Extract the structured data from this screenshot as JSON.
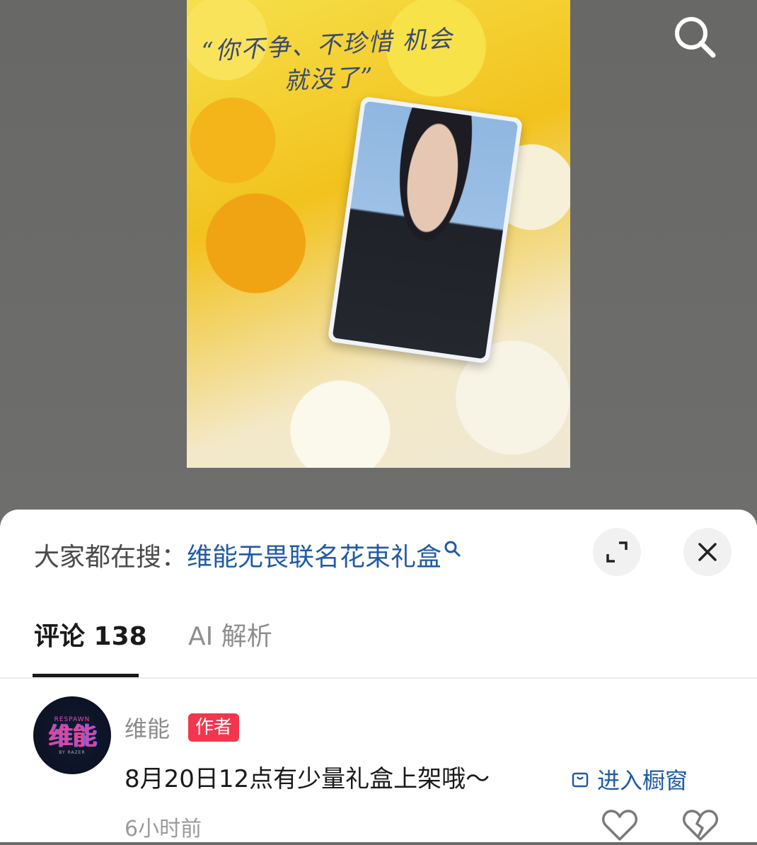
{
  "poster": {
    "quote": "“你不争、不珍惜 机会就没了”",
    "search_icon": "search-icon"
  },
  "sheet": {
    "suggest_label": "大家都在搜：",
    "suggest_term": "维能无畏联名花束礼盒",
    "expand_icon": "expand-icon",
    "close_icon": "close-icon"
  },
  "tabs": {
    "comments": "评论 138",
    "ai": "AI 解析"
  },
  "comment": {
    "avatar_small": "RESPAWN",
    "avatar_big": "维能",
    "avatar_tiny": "BY RAZER",
    "author": "维能",
    "badge": "作者",
    "text": "8月20日12点有少量礼盒上架哦～",
    "store_link": "进入橱窗",
    "time": "6小时前"
  },
  "colors": {
    "accent_link": "#1f5aa6",
    "badge_red": "#f2364d",
    "backdrop": "#6b6b69"
  }
}
